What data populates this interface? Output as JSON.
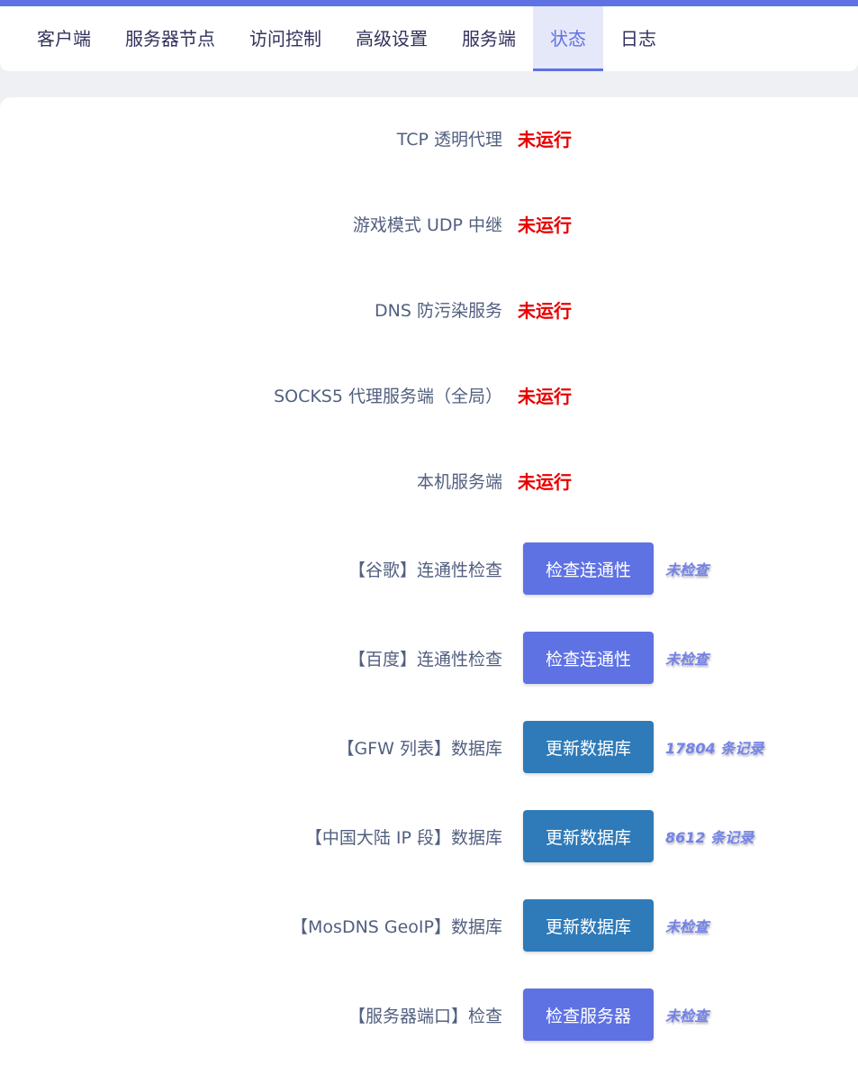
{
  "tabs": [
    {
      "label": "客户端"
    },
    {
      "label": "服务器节点"
    },
    {
      "label": "访问控制"
    },
    {
      "label": "高级设置"
    },
    {
      "label": "服务端"
    },
    {
      "label": "状态",
      "active": true
    },
    {
      "label": "日志"
    }
  ],
  "services": [
    {
      "label": "TCP 透明代理",
      "status": "未运行"
    },
    {
      "label": "游戏模式 UDP 中继",
      "status": "未运行"
    },
    {
      "label": "DNS 防污染服务",
      "status": "未运行"
    },
    {
      "label": "SOCKS5 代理服务端（全局）",
      "status": "未运行"
    },
    {
      "label": "本机服务端",
      "status": "未运行"
    }
  ],
  "checks": [
    {
      "label": "【谷歌】连通性检查",
      "button": "检查连通性",
      "result": "未检查"
    },
    {
      "label": "【百度】连通性检查",
      "button": "检查连通性",
      "result": "未检查"
    },
    {
      "label": "【GFW 列表】数据库",
      "button": "更新数据库",
      "result": "17804 条记录"
    },
    {
      "label": "【中国大陆 IP 段】数据库",
      "button": "更新数据库",
      "result": "8612 条记录"
    },
    {
      "label": "【MosDNS GeoIP】数据库",
      "button": "更新数据库",
      "result": "未检查"
    },
    {
      "label": "【服务器端口】检查",
      "button": "检查服务器",
      "result": "未检查"
    }
  ],
  "colors": {
    "accent": "#5e72e4",
    "update_button": "#2f7ab8",
    "not_running": "#e80000"
  }
}
